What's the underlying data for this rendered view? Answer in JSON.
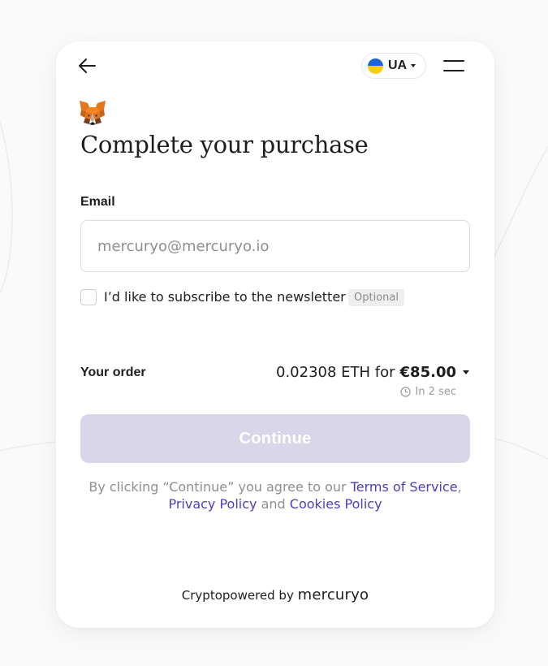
{
  "header": {
    "back_icon": "arrow-left-icon",
    "language": {
      "code": "UA",
      "flag": "ukraine-flag-icon"
    },
    "menu_icon": "hamburger-menu-icon"
  },
  "brand_logo": "metamask-fox-icon",
  "title": "Complete your purchase",
  "email": {
    "label": "Email",
    "value": "",
    "placeholder": "mercuryo@mercuryo.io"
  },
  "newsletter": {
    "checked": false,
    "label": "I’d like to subscribe to the newsletter",
    "badge": "Optional"
  },
  "order": {
    "label": "Your order",
    "crypto_amount": "0.02308 ETH for",
    "fiat_amount": "€85.00",
    "timer": "In 2 sec"
  },
  "continue": {
    "label": "Continue",
    "disabled": true
  },
  "terms": {
    "prefix": "By clicking “Continue” you agree to our ",
    "terms_link": "Terms of Service",
    "comma": ",",
    "privacy_link": "Privacy Policy",
    "and": " and ",
    "cookies_link": "Cookies Policy"
  },
  "footer": {
    "prefix": "Cryptopowered by",
    "brand": "mercuryo"
  },
  "colors": {
    "accent_link": "#4a3fb8",
    "button_disabled": "#d9d6ea",
    "flag_blue": "#1a63d8",
    "flag_yellow": "#f9cc16"
  }
}
